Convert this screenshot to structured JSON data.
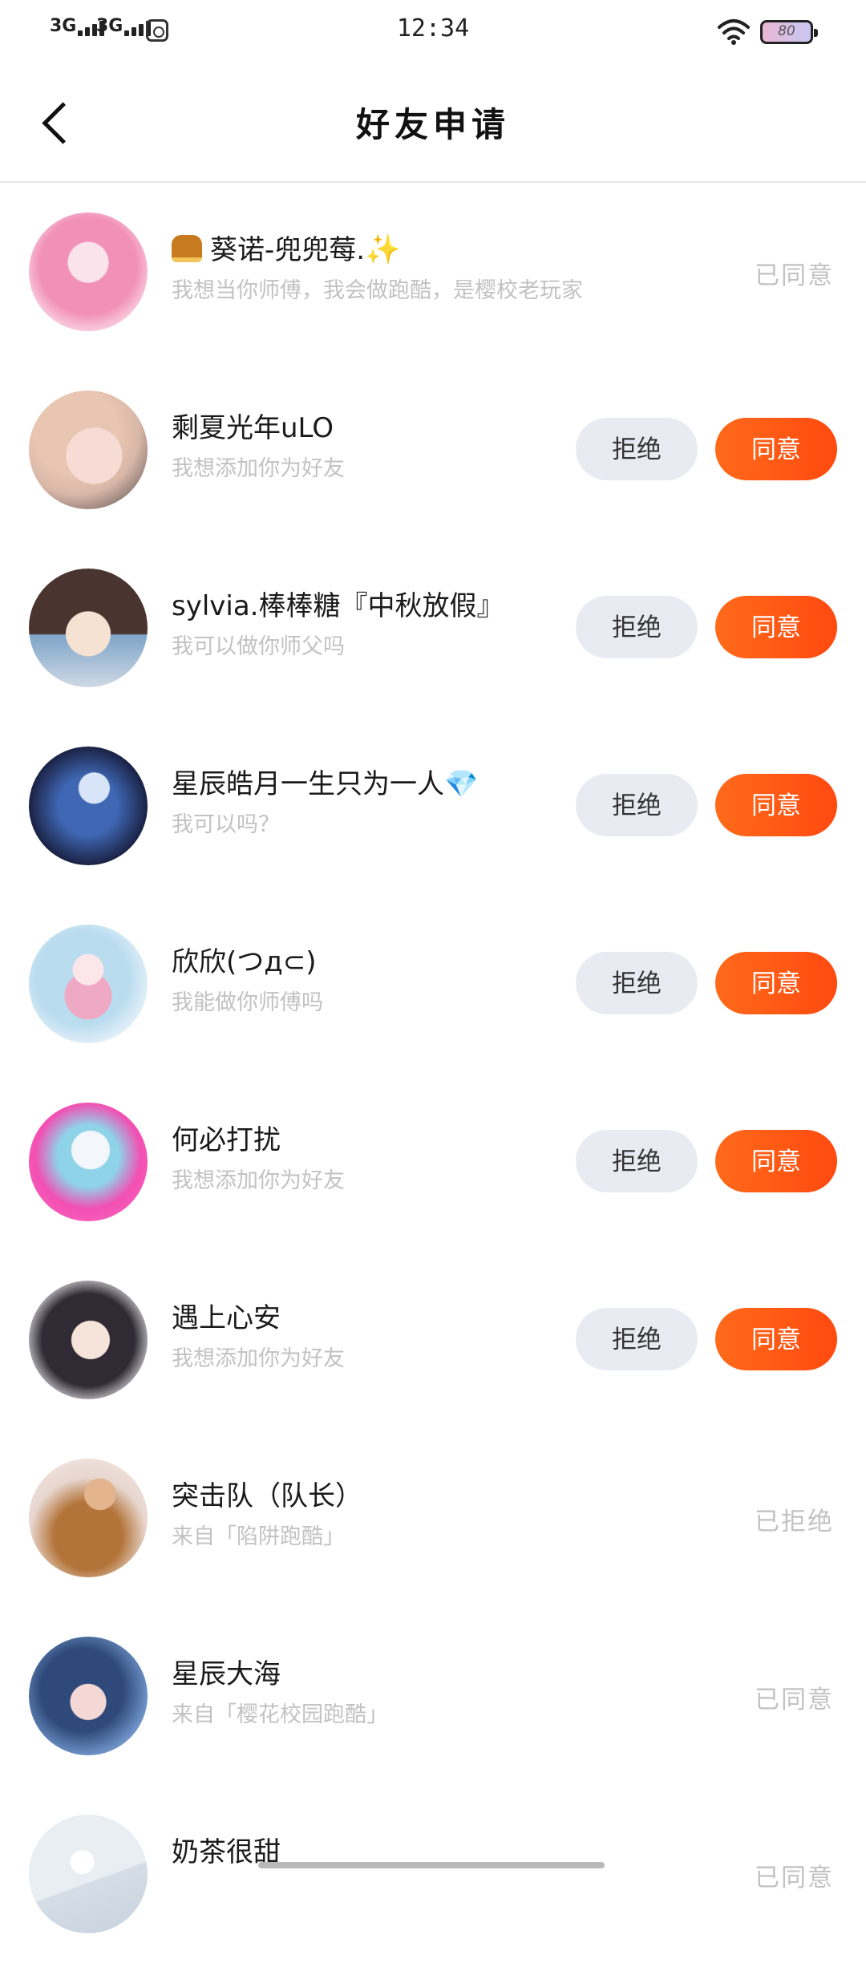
{
  "status_bar": {
    "signal1": "3G",
    "signal2": "3G",
    "time": "12:34",
    "battery": "80"
  },
  "header": {
    "title": "好友申请"
  },
  "colors": {
    "accept": "#ff5a14",
    "reject_bg": "#e8ebf2",
    "muted_text": "#c2c2c2"
  },
  "requests": [
    {
      "name": "葵诺-兜兜莓.",
      "message": "我想当你师傅，我会做跑酷，是樱校老玩家",
      "status": "已同意",
      "avatar_icon": "pink-hair-girl-avatar"
    },
    {
      "name": "剩夏光年uLO",
      "message": "我想添加你为好友",
      "reject_label": "拒绝",
      "accept_label": "同意",
      "avatar_icon": "blonde-girl-avatar"
    },
    {
      "name": "sylvia.棒棒糖『中秋放假』",
      "message": "我可以做你师父吗",
      "reject_label": "拒绝",
      "accept_label": "同意",
      "avatar_icon": "dark-hair-girl-avatar"
    },
    {
      "name": "星辰皓月一生只为一人",
      "message": "我可以吗？",
      "reject_label": "拒绝",
      "accept_label": "同意",
      "avatar_icon": "blue-cyber-girl-avatar"
    },
    {
      "name": "欣欣(つд⊂)",
      "message": "我能做你师傅吗",
      "reject_label": "拒绝",
      "accept_label": "同意",
      "avatar_icon": "light-blue-hair-girl-avatar"
    },
    {
      "name": "何必打扰",
      "message": "我想添加你为好友",
      "reject_label": "拒绝",
      "accept_label": "同意",
      "avatar_icon": "pink-pop-avatar"
    },
    {
      "name": "遇上心安",
      "message": "我想添加你为好友",
      "reject_label": "拒绝",
      "accept_label": "同意",
      "avatar_icon": "black-hair-girl-avatar"
    },
    {
      "name": "突击队（队长）",
      "message": "来自「陷阱跑酷」",
      "status": "已拒绝",
      "avatar_icon": "man-guitar-avatar"
    },
    {
      "name": "星辰大海",
      "message": "来自「樱花校园跑酷」",
      "status": "已同意",
      "avatar_icon": "navy-hair-girl-avatar"
    },
    {
      "name": "奶茶很甜",
      "message": "",
      "status": "已同意",
      "avatar_icon": "placeholder-avatar"
    }
  ]
}
